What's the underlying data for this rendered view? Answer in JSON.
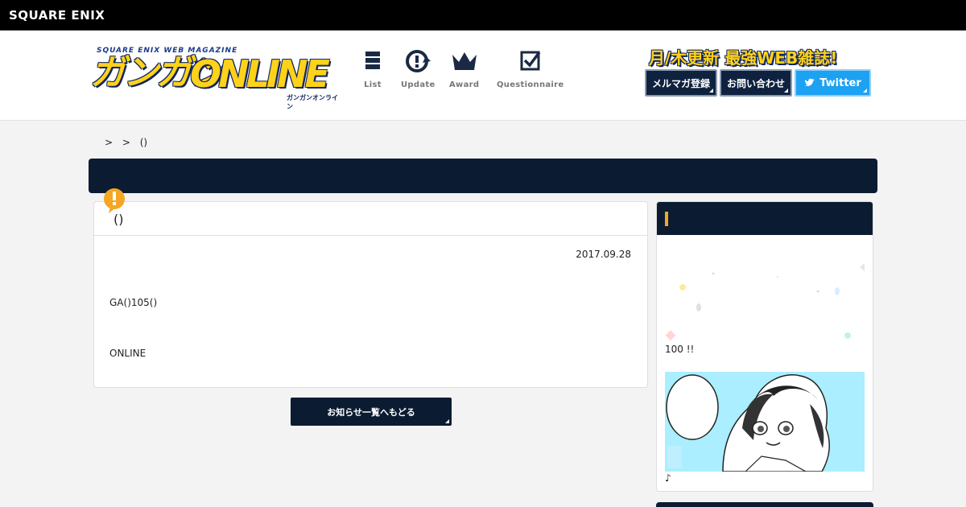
{
  "topbar": {
    "brand": "SQUARE ENIX"
  },
  "logo": {
    "tagline": "SQUARE ENIX WEB MAGAZINE",
    "kana": "ガンガン",
    "word": "ONLINE",
    "reading": "ガンガンオンライン"
  },
  "nav": [
    {
      "label": "List",
      "icon": "list-icon"
    },
    {
      "label": "Update",
      "icon": "update-icon"
    },
    {
      "label": "Award",
      "icon": "crown-icon"
    },
    {
      "label": "Questionnaire",
      "icon": "checkbox-icon"
    }
  ],
  "header": {
    "promo": "月/木更新 最強WEB雑誌!",
    "buttons": {
      "mailmag": "メルマガ登録",
      "contact": "お問い合わせ",
      "twitter": "Twitter"
    }
  },
  "breadcrumb": ">   > ()",
  "article": {
    "title": "()",
    "date": "2017.09.28",
    "body1": "GA()105()",
    "body2": "ONLINE",
    "back_button": "お知らせ一覧へもどる"
  },
  "sidebar": {
    "caption1": "100 !!",
    "caption2": "♪"
  },
  "colors": {
    "navy": "#0b1b32",
    "logo_yellow": "#ffd21a",
    "twitter": "#1da1f2",
    "alert": "#f5a623"
  }
}
